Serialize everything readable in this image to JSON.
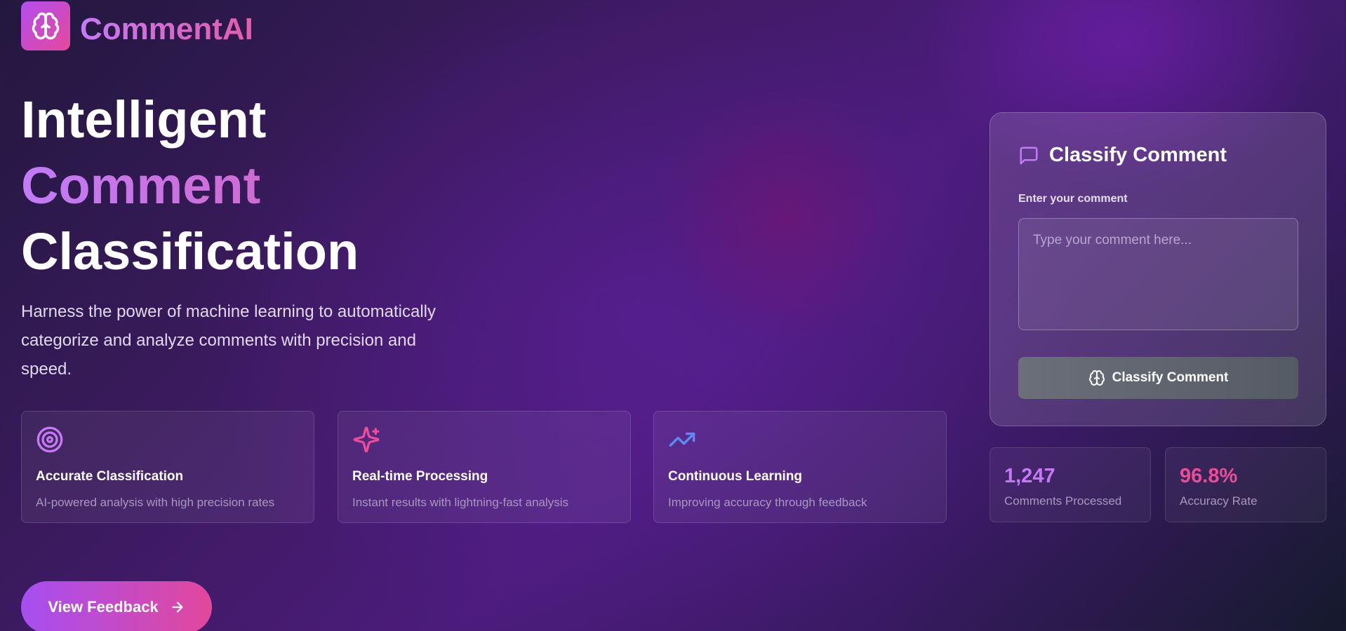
{
  "app": {
    "name": "CommentAI",
    "logo_icon": "brain-icon"
  },
  "hero": {
    "title_line1": "Intelligent",
    "title_line2": "Comment",
    "title_line3": "Classification",
    "description": "Harness the power of machine learning to automatically categorize and analyze comments with precision and speed."
  },
  "features": [
    {
      "icon": "target-icon",
      "icon_color": "#c57af5",
      "title": "Accurate Classification",
      "description": "AI-powered analysis with high precision rates"
    },
    {
      "icon": "sparkles-icon",
      "icon_color": "#ec4c98",
      "title": "Real-time Processing",
      "description": "Instant results with lightning-fast analysis"
    },
    {
      "icon": "trending-up-icon",
      "icon_color": "#5b8cf0",
      "title": "Continuous Learning",
      "description": "Improving accuracy through feedback"
    }
  ],
  "feedback_button": {
    "label": "View Feedback",
    "icon": "arrow-right-icon"
  },
  "classify_panel": {
    "title": "Classify Comment",
    "title_icon": "message-square-icon",
    "field_label": "Enter your comment",
    "input_value": "",
    "input_placeholder": "Type your comment here...",
    "button_label": "Classify Comment",
    "button_icon": "brain-icon"
  },
  "stats": [
    {
      "value": "1,247",
      "label": "Comments Processed",
      "color": "#c57af5"
    },
    {
      "value": "96.8%",
      "label": "Accuracy Rate",
      "color": "#ec4c98"
    }
  ],
  "colors": {
    "accent_purple": "#a64ef2",
    "accent_pink": "#e2489b"
  }
}
